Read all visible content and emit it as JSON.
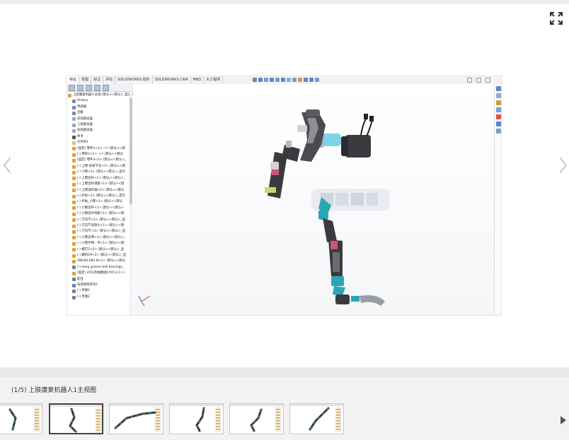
{
  "viewer": {
    "command_tabs": [
      "特征",
      "草图",
      "标注",
      "评估",
      "SOLIDWORKS 插件",
      "SOLIDWORKS CAM",
      "MBD",
      "大工程师"
    ],
    "active_tab_index": 0,
    "tree_items": [
      {
        "label": "上肢康复机器人主视 (默认<<默认>_显示状态 1>)",
        "icon": "assembly-icon",
        "color": "#d9a23a"
      },
      {
        "label": "History",
        "icon": "history-icon",
        "color": "#7a8aa8"
      },
      {
        "label": "传感器",
        "icon": "sensor-icon",
        "color": "#7a8aa8"
      },
      {
        "label": "注解",
        "icon": "annotation-icon",
        "color": "#7a8aa8"
      },
      {
        "label": "前视基准面",
        "icon": "plane-icon",
        "color": "#9aa9bd"
      },
      {
        "label": "上视基准面",
        "icon": "plane-icon",
        "color": "#9aa9bd"
      },
      {
        "label": "右视基准面",
        "icon": "plane-icon",
        "color": "#9aa9bd"
      },
      {
        "label": "原点",
        "icon": "origin-icon",
        "color": "#555555"
      },
      {
        "label": "文件夹1",
        "icon": "folder-icon",
        "color": "#e2c46a"
      },
      {
        "label": "(固定) 零件1<1> ->? (默认<<默",
        "icon": "part-icon",
        "color": "#d9a23a"
      },
      {
        "label": "(-) 零件2<1> ->? (默认<<默认",
        "icon": "part-icon",
        "color": "#d9a23a"
      },
      {
        "label": "(固定) 零件3<2> (默认<<默认>_",
        "icon": "part-icon",
        "color": "#d9a23a"
      },
      {
        "label": "(-) 上臂-肘关节车<1> (默认<<默",
        "icon": "part-icon",
        "color": "#d9a23a"
      },
      {
        "label": "(-) 小臂<1> (默认<<默认>_显示",
        "icon": "part-icon",
        "color": "#d9a23a"
      },
      {
        "label": "(-) 上臂连杆<1> (默认<<默认>_",
        "icon": "part-icon",
        "color": "#d9a23a"
      },
      {
        "label": "(-) 上臂连杆滑套<1> (默认<<默",
        "icon": "part-icon",
        "color": "#d9a23a"
      },
      {
        "label": "(-) 上臂滚轮轴<1> (默认<<默认",
        "icon": "part-icon",
        "color": "#d9a23a"
      },
      {
        "label": "(-) 护板<1> (默认<<默认>_显示",
        "icon": "part-icon",
        "color": "#d9a23a"
      },
      {
        "label": "(-) 护板_小臂<1> (默认<<默认",
        "icon": "part-icon",
        "color": "#d9a23a"
      },
      {
        "label": "(-) 小臂连杆<1> (默认<<默认>",
        "icon": "part-icon",
        "color": "#d9a23a"
      },
      {
        "label": "(-) 小臂连杆滑套<1> (默认<<默",
        "icon": "part-icon",
        "color": "#d9a23a"
      },
      {
        "label": "(-) 万向节<1> (默认<<默认>_显",
        "icon": "part-icon",
        "color": "#d9a23a"
      },
      {
        "label": "(-) 万向节滚珠头<1> (默认<<默",
        "icon": "part-icon",
        "color": "#d9a23a"
      },
      {
        "label": "(-) 万向节<3> (默认<<默认>_显",
        "icon": "part-icon",
        "color": "#d9a23a"
      },
      {
        "label": "(-) 小臂支撑<1> (默认<<默认>_",
        "icon": "part-icon",
        "color": "#d9a23a"
      },
      {
        "label": "(-) 小臂手柄 - 手<1> (默认<<默",
        "icon": "part-icon",
        "color": "#d9a23a"
      },
      {
        "label": "(-) 螺钉2<2> (默认<<默认>_显",
        "icon": "part-icon",
        "color": "#d9a23a"
      },
      {
        "label": "(-) 螺纹29<2> (默认<<默认>_显",
        "icon": "part-icon",
        "color": "#d9a23a"
      },
      {
        "label": "ZNH04-082-N<1> (默认<<默认",
        "icon": "part-icon",
        "color": "#d9a23a"
      },
      {
        "label": "(-) deep groove ball bearings_",
        "icon": "bearing-icon",
        "color": "#6e7f9a"
      },
      {
        "label": "(固定) LY91直线模组[LY91]<1> (",
        "icon": "part-icon",
        "color": "#d9a23a"
      },
      {
        "label": "配合",
        "icon": "mate-icon",
        "color": "#6e7f9a"
      },
      {
        "label": "局部线性阵列1",
        "icon": "pattern-icon",
        "color": "#6e7f9a"
      },
      {
        "label": "(-) 草图1",
        "icon": "sketch-icon",
        "color": "#6e7f9a"
      },
      {
        "label": "(-) 草图2",
        "icon": "sketch-icon",
        "color": "#6e7f9a"
      }
    ]
  },
  "caption": "(1/5) 上肢康复机器人1主视图",
  "thumbnails": [
    {
      "name": "thumbnail-1",
      "selected": false
    },
    {
      "name": "thumbnail-2",
      "selected": true
    },
    {
      "name": "thumbnail-3",
      "selected": false
    },
    {
      "name": "thumbnail-4",
      "selected": false
    },
    {
      "name": "thumbnail-5",
      "selected": false
    },
    {
      "name": "thumbnail-6",
      "selected": false
    }
  ],
  "colors": {
    "accent_teal": "#2aa6b3",
    "robot_dark": "#3b3b3f",
    "motor_cyan": "#7fd3e6",
    "tree_folder": "#e2c46a"
  }
}
